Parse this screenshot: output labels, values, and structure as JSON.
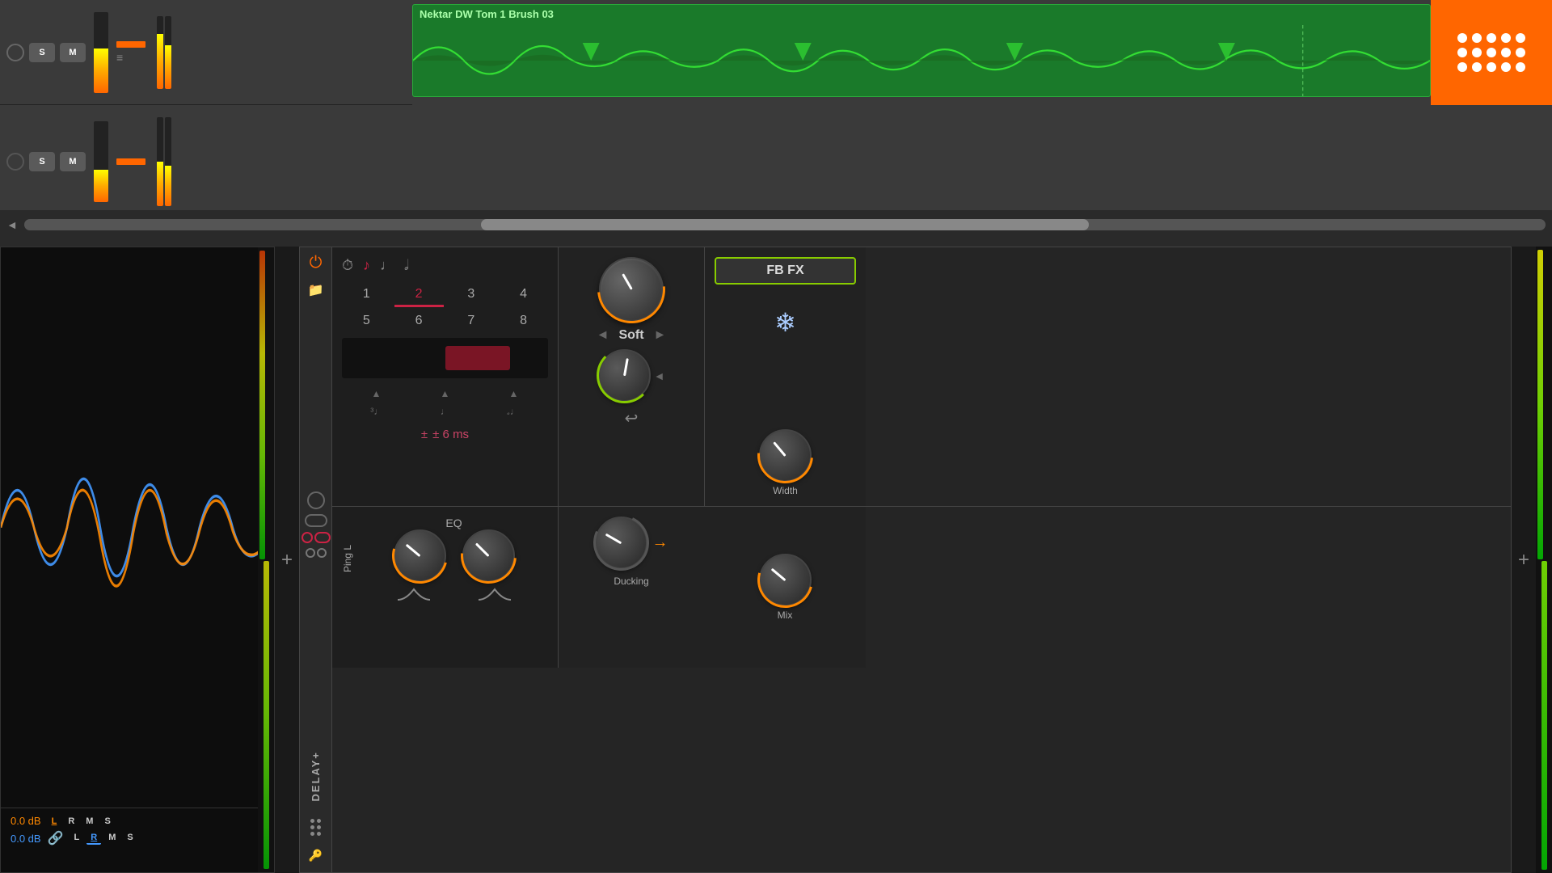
{
  "daw": {
    "track1": {
      "buttons": {
        "s": "S",
        "m": "M"
      },
      "clip_name": "Nektar DW Tom 1 Brush 03"
    },
    "track2": {
      "buttons": {
        "s": "S",
        "m": "M"
      }
    },
    "scroll_arrow": "◄"
  },
  "waveform_display": {
    "db_orange": "0.0 dB",
    "db_blue": "0.0 dB",
    "channels_orange": [
      "L",
      "R",
      "M",
      "S"
    ],
    "channels_blue": [
      "L",
      "R",
      "M",
      "S"
    ]
  },
  "delay_plugin": {
    "label": "DELAY+",
    "icons": {
      "power": "⏻",
      "folder": "🗁",
      "dots": "⋮⋮",
      "key": "🔑"
    },
    "time_section": {
      "note_icons": [
        "⏱",
        "♪",
        "♩",
        "𝅘𝅥"
      ],
      "numbers": [
        "1",
        "2",
        "3",
        "4",
        "5",
        "6",
        "7",
        "8"
      ],
      "selected_num": "2",
      "delay_ms": "± 6 ms"
    },
    "character_section": {
      "label": "Soft",
      "nav_left": "◄",
      "nav_right": "►"
    },
    "fbfx_section": {
      "title": "FB FX",
      "freeze": "❄"
    },
    "eq_section": {
      "label": "EQ"
    },
    "ducking_section": {
      "label": "Ducking"
    },
    "width_section": {
      "label": "Width"
    },
    "mix_section": {
      "label": "Mix"
    },
    "ping_label": "Ping L",
    "plus_right": "+"
  },
  "meters": {
    "left_add": "+",
    "right_add": "+"
  }
}
